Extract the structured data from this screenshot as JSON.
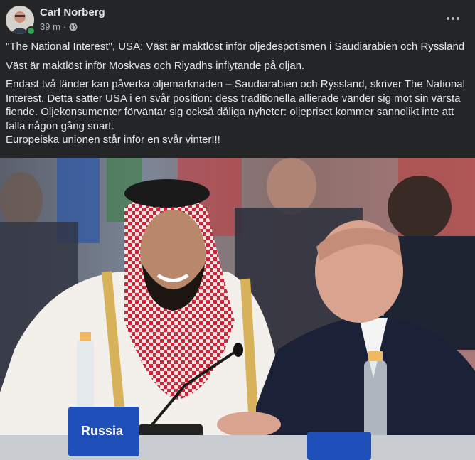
{
  "post": {
    "author": "Carl Norberg",
    "time": "39 m",
    "separator": "·",
    "privacy_icon": "globe-icon",
    "more_icon": "more-horizontal-icon",
    "paragraphs": [
      "\"The National Interest\", USA: Väst är maktlöst inför oljedespotismen i Saudiarabien och Ryssland",
      "Väst är maktlöst inför Moskvas och Riyadhs inflytande på oljan.",
      "Endast två länder kan påverka oljemarknaden – Saudiarabien och Ryssland, skriver The National Interest. Detta sätter USA i en svår position: dess traditionella allierade vänder sig mot sin värsta fiende. Oljekonsumenter förväntar sig också dåliga nyheter: oljepriset kommer sannolikt inte att falla någon gång snart.",
      "Europeiska unionen står inför en svår vinter!!!"
    ],
    "photo": {
      "placard_text": "Russia"
    }
  },
  "colors": {
    "background": "#242526",
    "text_primary": "#e4e6eb",
    "text_secondary": "#b0b3b8",
    "online": "#31a24c",
    "placard": "#1f4fb8"
  }
}
